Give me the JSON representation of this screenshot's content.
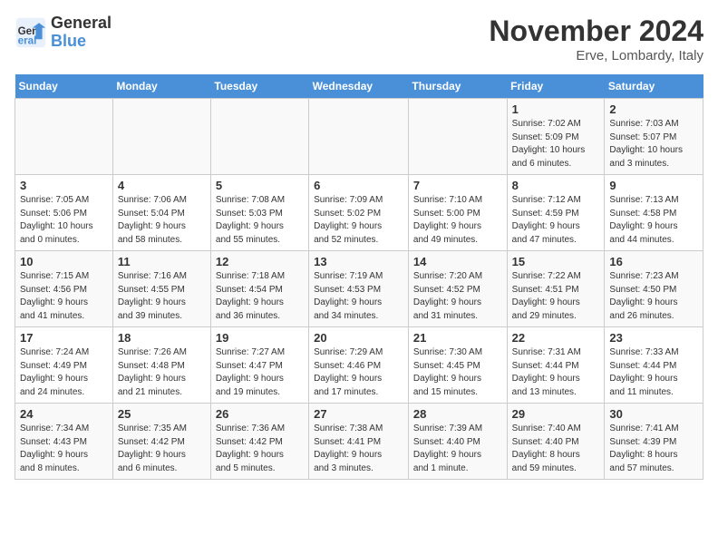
{
  "header": {
    "logo_line1": "General",
    "logo_line2": "Blue",
    "month": "November 2024",
    "location": "Erve, Lombardy, Italy"
  },
  "weekdays": [
    "Sunday",
    "Monday",
    "Tuesday",
    "Wednesday",
    "Thursday",
    "Friday",
    "Saturday"
  ],
  "weeks": [
    [
      {
        "day": "",
        "info": ""
      },
      {
        "day": "",
        "info": ""
      },
      {
        "day": "",
        "info": ""
      },
      {
        "day": "",
        "info": ""
      },
      {
        "day": "",
        "info": ""
      },
      {
        "day": "1",
        "info": "Sunrise: 7:02 AM\nSunset: 5:09 PM\nDaylight: 10 hours\nand 6 minutes."
      },
      {
        "day": "2",
        "info": "Sunrise: 7:03 AM\nSunset: 5:07 PM\nDaylight: 10 hours\nand 3 minutes."
      }
    ],
    [
      {
        "day": "3",
        "info": "Sunrise: 7:05 AM\nSunset: 5:06 PM\nDaylight: 10 hours\nand 0 minutes."
      },
      {
        "day": "4",
        "info": "Sunrise: 7:06 AM\nSunset: 5:04 PM\nDaylight: 9 hours\nand 58 minutes."
      },
      {
        "day": "5",
        "info": "Sunrise: 7:08 AM\nSunset: 5:03 PM\nDaylight: 9 hours\nand 55 minutes."
      },
      {
        "day": "6",
        "info": "Sunrise: 7:09 AM\nSunset: 5:02 PM\nDaylight: 9 hours\nand 52 minutes."
      },
      {
        "day": "7",
        "info": "Sunrise: 7:10 AM\nSunset: 5:00 PM\nDaylight: 9 hours\nand 49 minutes."
      },
      {
        "day": "8",
        "info": "Sunrise: 7:12 AM\nSunset: 4:59 PM\nDaylight: 9 hours\nand 47 minutes."
      },
      {
        "day": "9",
        "info": "Sunrise: 7:13 AM\nSunset: 4:58 PM\nDaylight: 9 hours\nand 44 minutes."
      }
    ],
    [
      {
        "day": "10",
        "info": "Sunrise: 7:15 AM\nSunset: 4:56 PM\nDaylight: 9 hours\nand 41 minutes."
      },
      {
        "day": "11",
        "info": "Sunrise: 7:16 AM\nSunset: 4:55 PM\nDaylight: 9 hours\nand 39 minutes."
      },
      {
        "day": "12",
        "info": "Sunrise: 7:18 AM\nSunset: 4:54 PM\nDaylight: 9 hours\nand 36 minutes."
      },
      {
        "day": "13",
        "info": "Sunrise: 7:19 AM\nSunset: 4:53 PM\nDaylight: 9 hours\nand 34 minutes."
      },
      {
        "day": "14",
        "info": "Sunrise: 7:20 AM\nSunset: 4:52 PM\nDaylight: 9 hours\nand 31 minutes."
      },
      {
        "day": "15",
        "info": "Sunrise: 7:22 AM\nSunset: 4:51 PM\nDaylight: 9 hours\nand 29 minutes."
      },
      {
        "day": "16",
        "info": "Sunrise: 7:23 AM\nSunset: 4:50 PM\nDaylight: 9 hours\nand 26 minutes."
      }
    ],
    [
      {
        "day": "17",
        "info": "Sunrise: 7:24 AM\nSunset: 4:49 PM\nDaylight: 9 hours\nand 24 minutes."
      },
      {
        "day": "18",
        "info": "Sunrise: 7:26 AM\nSunset: 4:48 PM\nDaylight: 9 hours\nand 21 minutes."
      },
      {
        "day": "19",
        "info": "Sunrise: 7:27 AM\nSunset: 4:47 PM\nDaylight: 9 hours\nand 19 minutes."
      },
      {
        "day": "20",
        "info": "Sunrise: 7:29 AM\nSunset: 4:46 PM\nDaylight: 9 hours\nand 17 minutes."
      },
      {
        "day": "21",
        "info": "Sunrise: 7:30 AM\nSunset: 4:45 PM\nDaylight: 9 hours\nand 15 minutes."
      },
      {
        "day": "22",
        "info": "Sunrise: 7:31 AM\nSunset: 4:44 PM\nDaylight: 9 hours\nand 13 minutes."
      },
      {
        "day": "23",
        "info": "Sunrise: 7:33 AM\nSunset: 4:44 PM\nDaylight: 9 hours\nand 11 minutes."
      }
    ],
    [
      {
        "day": "24",
        "info": "Sunrise: 7:34 AM\nSunset: 4:43 PM\nDaylight: 9 hours\nand 8 minutes."
      },
      {
        "day": "25",
        "info": "Sunrise: 7:35 AM\nSunset: 4:42 PM\nDaylight: 9 hours\nand 6 minutes."
      },
      {
        "day": "26",
        "info": "Sunrise: 7:36 AM\nSunset: 4:42 PM\nDaylight: 9 hours\nand 5 minutes."
      },
      {
        "day": "27",
        "info": "Sunrise: 7:38 AM\nSunset: 4:41 PM\nDaylight: 9 hours\nand 3 minutes."
      },
      {
        "day": "28",
        "info": "Sunrise: 7:39 AM\nSunset: 4:40 PM\nDaylight: 9 hours\nand 1 minute."
      },
      {
        "day": "29",
        "info": "Sunrise: 7:40 AM\nSunset: 4:40 PM\nDaylight: 8 hours\nand 59 minutes."
      },
      {
        "day": "30",
        "info": "Sunrise: 7:41 AM\nSunset: 4:39 PM\nDaylight: 8 hours\nand 57 minutes."
      }
    ]
  ]
}
